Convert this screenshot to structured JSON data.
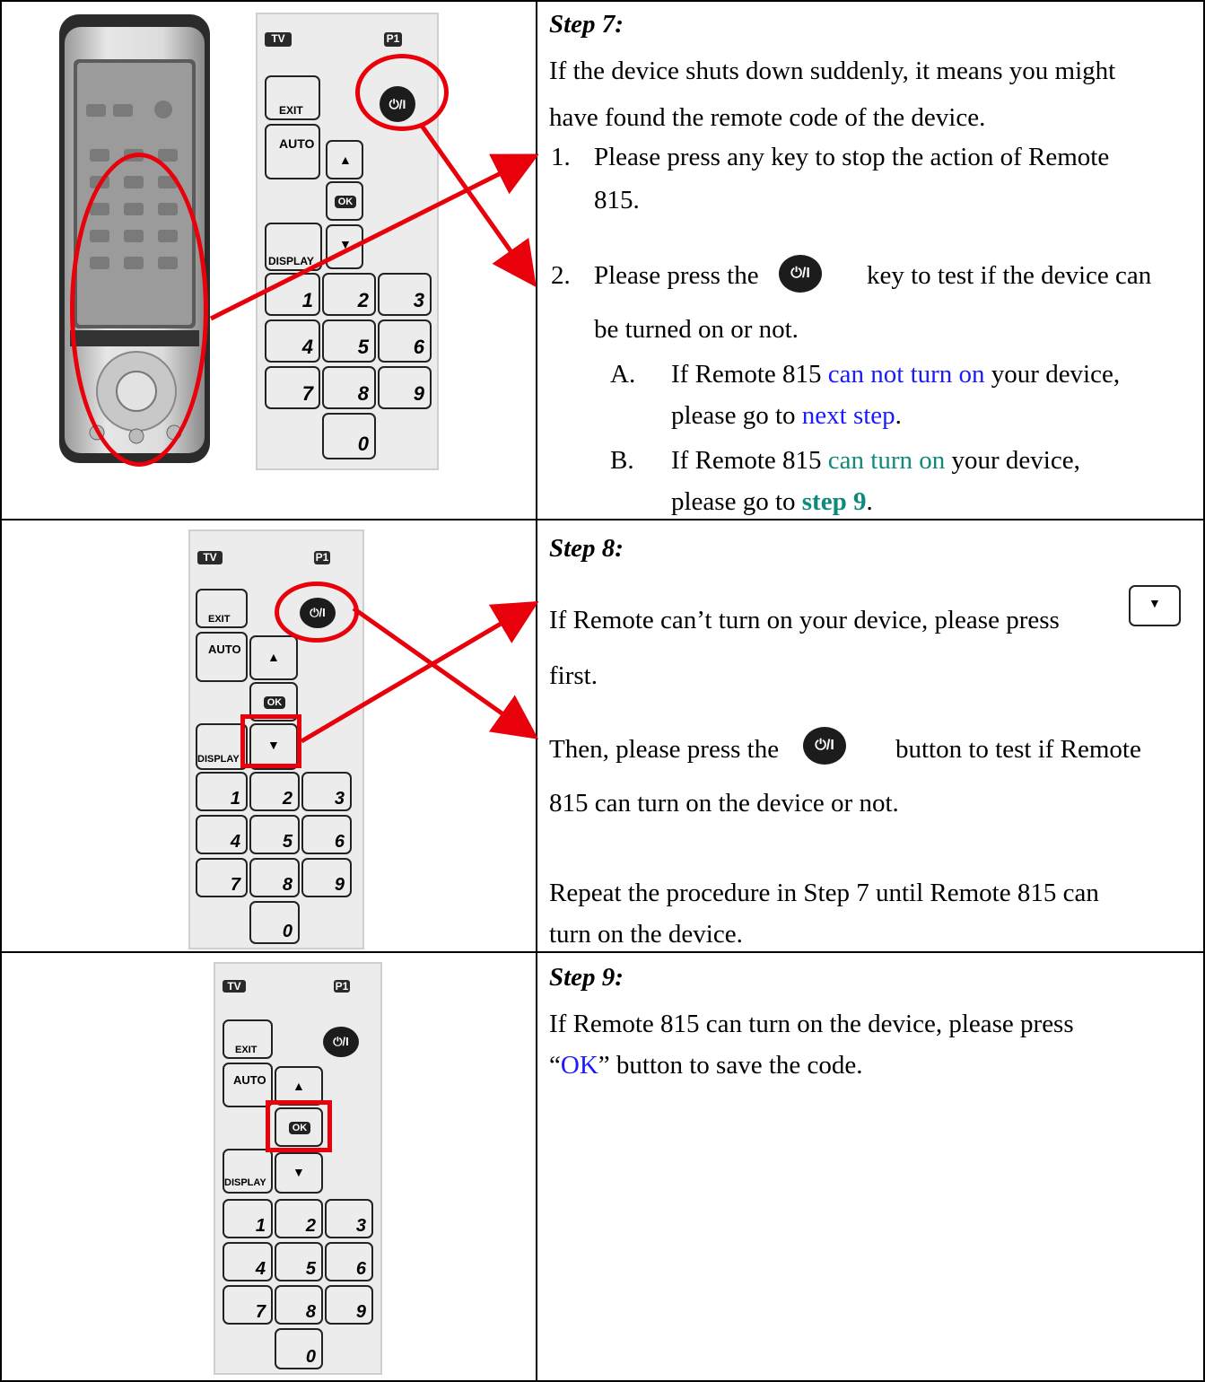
{
  "remote_labels": {
    "tv": "TV",
    "p1": "P1",
    "exit": "EXIT",
    "auto": "AUTO",
    "ok": "OK",
    "display": "DISPLAY",
    "power": "⏻/I",
    "up": "▲",
    "down": "▼",
    "digits": [
      "1",
      "2",
      "3",
      "4",
      "5",
      "6",
      "7",
      "8",
      "9",
      "0"
    ]
  },
  "step7": {
    "title": "Step 7:",
    "intro_line1": "If the device shuts down suddenly, it means you might",
    "intro_line2": "have found the remote code of the device.",
    "item1_num": "1.",
    "item1_line1": "Please press any key to stop the action of Remote",
    "item1_line2": "815.",
    "item2_num": "2.",
    "item2_pre": "Please press the",
    "item2_post": "key to test if the device can",
    "item2_line2": "be turned on or not.",
    "a_label": "A.",
    "a_pre": "If Remote 815 ",
    "a_hl": "can not turn on",
    "a_post": " your device,",
    "a2_pre": "please go to ",
    "a2_hl": "next step",
    "a2_post": ".",
    "b_label": "B.",
    "b_pre": "If Remote 815 ",
    "b_hl": "can turn on",
    "b_post": " your device,",
    "b2_pre": "please go to ",
    "b2_hl": "step 9",
    "b2_post": "."
  },
  "step8": {
    "title": "Step 8:",
    "line1": "If Remote can’t turn on your device, please press",
    "line2": "first.",
    "line3_pre": "Then, please press the",
    "line3_post": "button to test if Remote",
    "line4": "815 can turn on the device or not.",
    "line5": "Repeat the procedure in Step 7 until Remote 815 can",
    "line6": "turn on the device."
  },
  "step9": {
    "title": "Step 9:",
    "line1": "If Remote 815 can turn on the device, please press",
    "line2_q1": "“",
    "line2_hl": "OK",
    "line2_post": "” button to save the code."
  },
  "colors": {
    "highlight": "#e8000b",
    "blue_text": "#1a1aff",
    "teal_text": "#0f8a7a"
  }
}
